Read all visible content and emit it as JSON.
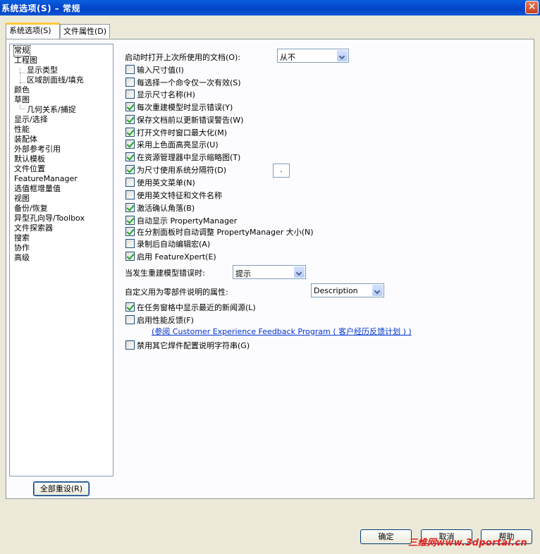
{
  "window": {
    "title": "系统选项(S) – 常规",
    "close_glyph": "✕"
  },
  "tabs": [
    {
      "label": "系统选项(S)"
    },
    {
      "label": "文件属性(D)"
    }
  ],
  "tree": [
    {
      "label": "常规",
      "selected": true
    },
    {
      "label": "工程图"
    },
    {
      "label": "显示类型",
      "level": 2
    },
    {
      "label": "区域剖面线/填充",
      "level": 2
    },
    {
      "label": "颜色"
    },
    {
      "label": "草图"
    },
    {
      "label": "几何关系/捕捉",
      "level": 2
    },
    {
      "label": "显示/选择"
    },
    {
      "label": "性能"
    },
    {
      "label": "装配体"
    },
    {
      "label": "外部参考引用"
    },
    {
      "label": "默认模板"
    },
    {
      "label": "文件位置"
    },
    {
      "label": "FeatureManager"
    },
    {
      "label": "选值框增量值"
    },
    {
      "label": "视图"
    },
    {
      "label": "备份/恢复"
    },
    {
      "label": "异型孔向导/Toolbox"
    },
    {
      "label": "文件探索器"
    },
    {
      "label": "搜索"
    },
    {
      "label": "协作"
    },
    {
      "label": "高级"
    }
  ],
  "reset_button": "全部重设(R)",
  "general": {
    "open_last_label": "启动时打开上次所使用的文档(O):",
    "open_last_value": "从不",
    "checkboxes": [
      {
        "label": "输入尺寸值(I)",
        "checked": false
      },
      {
        "label": "每选择一个命令仅一次有效(S)",
        "checked": false
      },
      {
        "label": "显示尺寸名称(H)",
        "checked": false
      },
      {
        "label": "每次重建模型时显示错误(Y)",
        "checked": true
      },
      {
        "label": "保存文档前以更新错误警告(W)",
        "checked": true
      },
      {
        "label": "打开文件时窗口最大化(M)",
        "checked": true
      },
      {
        "label": "采用上色面高亮显示(U)",
        "checked": true
      },
      {
        "label": "在资源管理器中显示缩略图(T)",
        "checked": true
      },
      {
        "label": "为尺寸使用系统分隔符(D)",
        "checked": true
      },
      {
        "label": "使用英文菜单(N)",
        "checked": false
      },
      {
        "label": "使用英文特征和文件名称",
        "checked": false
      },
      {
        "label": "激活确认角落(B)",
        "checked": true
      },
      {
        "label": "自动显示 PropertyManager",
        "checked": true
      },
      {
        "label": "在分割面板时自动调整 PropertyManager 大小(N)",
        "checked": true
      },
      {
        "label": "录制后自动编辑宏(A)",
        "checked": false
      },
      {
        "label": "启用 FeatureXpert(E)",
        "checked": true
      }
    ],
    "separator_value": ".",
    "rebuild_error_label": "当发生重建模型错误时:",
    "rebuild_error_value": "提示",
    "custom_prop_label": "自定义用为零部件说明的属性:",
    "custom_prop_value": "Description",
    "news_label": "在任务窗格中显示最近的新闻源(L)",
    "news_checked": true,
    "feedback_label": "启用性能反馈(F)",
    "feedback_checked": false,
    "feedback_link": "(参阅 Customer Experience Feedback Program ( 客户经历反馈计划 ) )",
    "weld_label": "禁用其它焊件配置说明字符串(G)",
    "weld_checked": false
  },
  "buttons": {
    "ok": "确定",
    "cancel": "取消",
    "help": "帮助"
  },
  "watermark": "三维网www.3dportal.cn"
}
